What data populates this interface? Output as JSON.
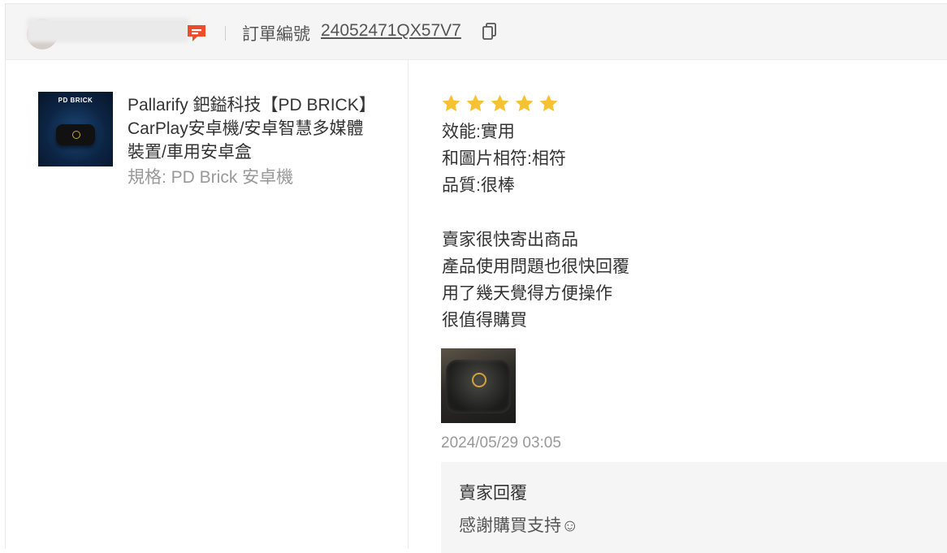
{
  "header": {
    "order_label": "訂單編號",
    "order_number": "24052471QX57V7"
  },
  "product": {
    "thumb_title": "PD BRICK",
    "name": "Pallarify 鈀鎰科技【PD BRICK】CarPlay安卓機/安卓智慧多媒體裝置/車用安卓盒",
    "spec": "規格: PD Brick 安卓機"
  },
  "review": {
    "rating": 5,
    "rating_max": 5,
    "star_color": "#f6c231",
    "lines": [
      "效能:實用",
      "和圖片相符:相符",
      "品質:很棒",
      "賣家很快寄出商品",
      "產品使用問題也很快回覆",
      "用了幾天覺得方便操作",
      "很值得購買"
    ],
    "timestamp": "2024/05/29 03:05"
  },
  "seller_reply": {
    "title": "賣家回覆",
    "text": "感謝購買支持☺"
  },
  "colors": {
    "accent": "#ee4d2d",
    "header_bg": "#f5f5f5"
  }
}
